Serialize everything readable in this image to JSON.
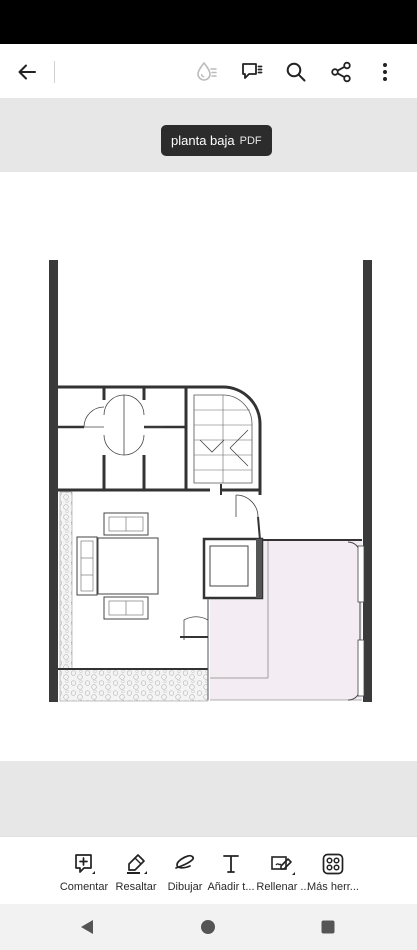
{
  "document": {
    "title": "planta baja",
    "type_badge": "PDF"
  },
  "app_bar": {
    "icons": [
      "back-arrow-icon",
      "reading-mode-icon",
      "comments-icon",
      "search-icon",
      "share-icon",
      "more-options-icon"
    ]
  },
  "bottom_toolbar": {
    "tools": [
      {
        "label": "Comentar",
        "icon": "comment-add-icon"
      },
      {
        "label": "Resaltar",
        "icon": "highlighter-icon"
      },
      {
        "label": "Dibujar",
        "icon": "draw-icon"
      },
      {
        "label": "Añadir t...",
        "icon": "add-text-icon"
      },
      {
        "label": "Rellenar ...",
        "icon": "fill-sign-icon"
      },
      {
        "label": "Más herr...",
        "icon": "more-tools-icon"
      }
    ]
  },
  "nav_bar": {
    "icons": [
      "nav-back-icon",
      "nav-home-icon",
      "nav-recents-icon"
    ]
  },
  "colors": {
    "status_bar": "#000000",
    "doc_background": "#e7e7e7",
    "tooltip_background": "#2c2c2c",
    "wall": "#3a3a3a",
    "terrace_fill": "#f3ecf2"
  }
}
